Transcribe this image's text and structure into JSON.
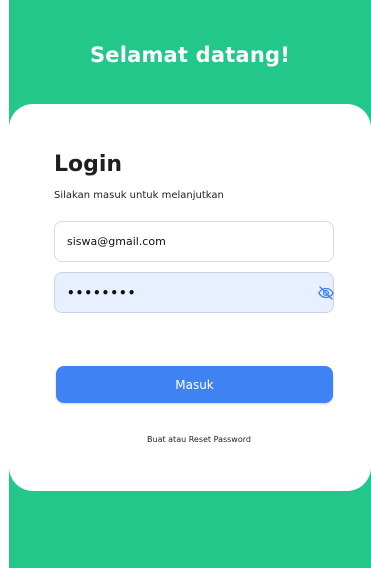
{
  "header": {
    "title": "Selamat datang!"
  },
  "login": {
    "title": "Login",
    "subtitle": "Silakan masuk untuk melanjutkan",
    "email_value": "siswa@gmail.com",
    "password_value": "••••••••",
    "submit_label": "Masuk",
    "reset_link": "Buat atau Reset Password"
  },
  "icons": {
    "password_toggle": "eye-off-icon"
  },
  "colors": {
    "background": "#24c78a",
    "button": "#3f82f4",
    "password_fill": "#e8efff",
    "icon": "#3f82f4"
  }
}
